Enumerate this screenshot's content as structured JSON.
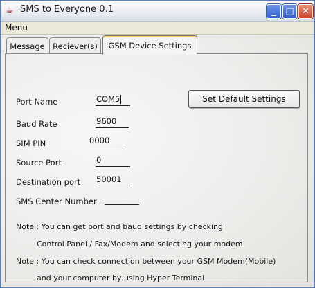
{
  "window": {
    "title": "SMS to Everyone 0.1",
    "icon": "java-cup-icon",
    "controls": {
      "minimize": "_",
      "maximize": "□",
      "close": "✕"
    }
  },
  "menu": {
    "items": [
      "Menu"
    ]
  },
  "tabs": [
    {
      "label": "Message",
      "active": false
    },
    {
      "label": "Reciever(s)",
      "active": false
    },
    {
      "label": "GSM Device Settings",
      "active": true
    }
  ],
  "gsm_settings": {
    "port_name": {
      "label": "Port Name",
      "value": "COM5"
    },
    "baud_rate": {
      "label": "Baud Rate",
      "value": "9600"
    },
    "sim_pin": {
      "label": "SIM PIN",
      "value": "0000"
    },
    "source_port": {
      "label": "Source Port",
      "value": "0"
    },
    "destination_port": {
      "label": "Destination port",
      "value": "50001"
    },
    "sms_center_number": {
      "label": "SMS Center Number",
      "value": ""
    },
    "set_default_button": "Set Default Settings",
    "notes": [
      "Note : You can get port and baud settings by checking",
      "Control Panel / Fax/Modem and selecting your modem",
      "Note : You can check connection between your GSM Modem(Mobile)",
      "and your computer by using Hyper Terminal"
    ]
  }
}
